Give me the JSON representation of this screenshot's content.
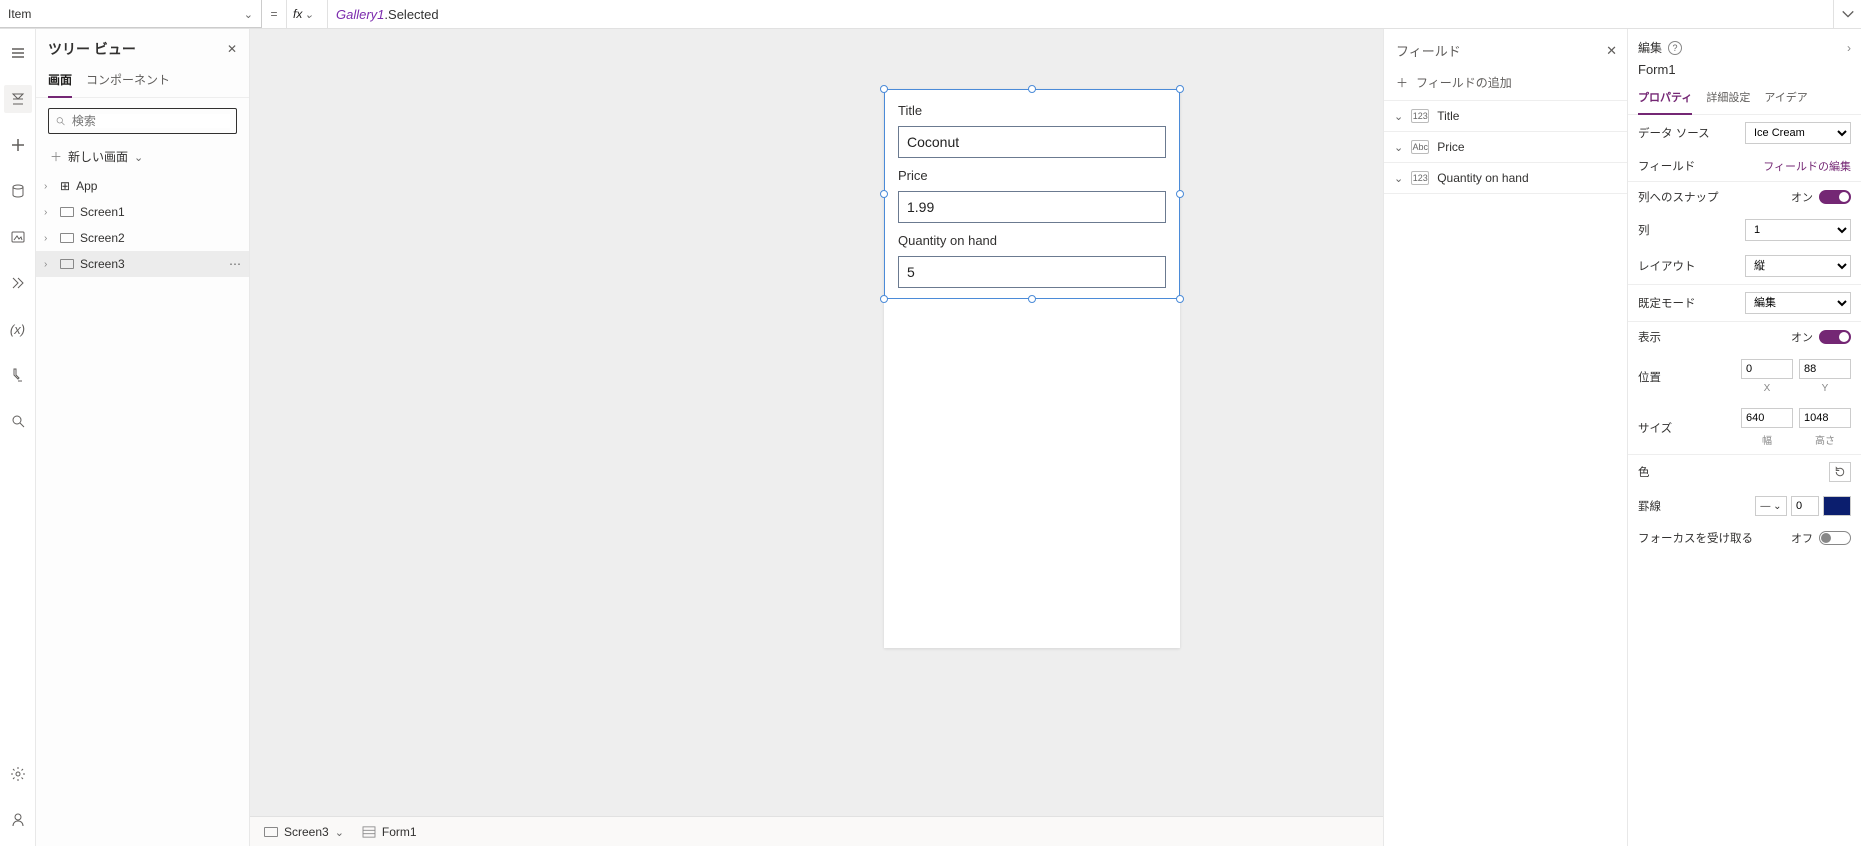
{
  "formula_bar": {
    "property": "Item",
    "fx_label": "fx",
    "expr_ident": "Gallery1",
    "expr_rest": ".Selected"
  },
  "tree": {
    "title": "ツリー ビュー",
    "tabs": {
      "screen": "画面",
      "component": "コンポーネント"
    },
    "search_placeholder": "検索",
    "new_screen": "新しい画面",
    "items": [
      {
        "label": "App",
        "type": "app"
      },
      {
        "label": "Screen1",
        "type": "screen"
      },
      {
        "label": "Screen2",
        "type": "screen"
      },
      {
        "label": "Screen3",
        "type": "screen",
        "selected": true
      }
    ]
  },
  "canvas_form": {
    "fields": [
      {
        "label": "Title",
        "value": "Coconut"
      },
      {
        "label": "Price",
        "value": "1.99"
      },
      {
        "label": "Quantity on hand",
        "value": "5"
      }
    ]
  },
  "breadcrumb": {
    "screen": "Screen3",
    "control": "Form1"
  },
  "fields_panel": {
    "title": "フィールド",
    "add_label": "フィールドの追加",
    "items": [
      {
        "type": "123",
        "label": "Title"
      },
      {
        "type": "Abc",
        "label": "Price"
      },
      {
        "type": "123",
        "label": "Quantity on hand"
      }
    ]
  },
  "props": {
    "edit_label": "編集",
    "control_name": "Form1",
    "tabs": {
      "prop": "プロパティ",
      "adv": "詳細設定",
      "idea": "アイデア"
    },
    "rows": {
      "data_source": {
        "lbl": "データ ソース",
        "value": "Ice Cream"
      },
      "fields": {
        "lbl": "フィールド",
        "link": "フィールドの編集"
      },
      "snap": {
        "lbl": "列へのスナップ",
        "state": "オン"
      },
      "columns": {
        "lbl": "列",
        "value": "1"
      },
      "layout": {
        "lbl": "レイアウト",
        "value": "縦"
      },
      "default_mode": {
        "lbl": "既定モード",
        "value": "編集"
      },
      "visible": {
        "lbl": "表示",
        "state": "オン"
      },
      "position": {
        "lbl": "位置",
        "x": "0",
        "y": "88",
        "xl": "X",
        "yl": "Y"
      },
      "size": {
        "lbl": "サイズ",
        "w": "640",
        "h": "1048",
        "wl": "幅",
        "hl": "高さ"
      },
      "color": {
        "lbl": "色"
      },
      "border": {
        "lbl": "罫線",
        "width": "0"
      },
      "focus": {
        "lbl": "フォーカスを受け取る",
        "state": "オフ"
      }
    }
  }
}
